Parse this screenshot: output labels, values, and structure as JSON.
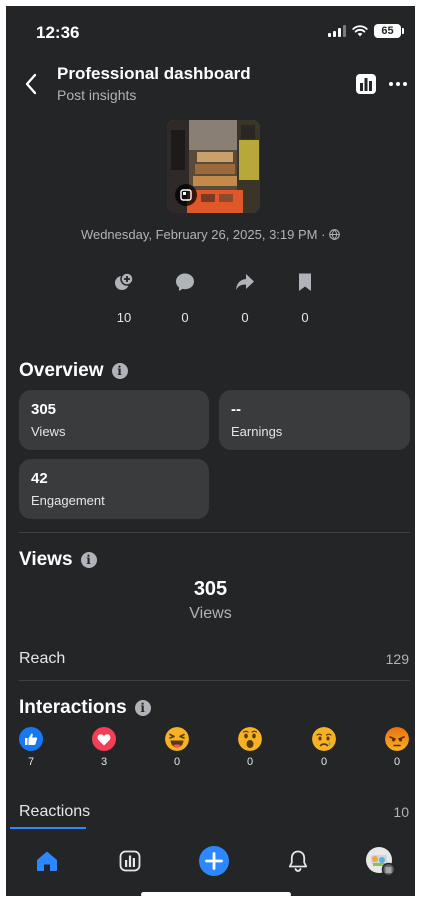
{
  "status_bar": {
    "time": "12:36",
    "battery": "65"
  },
  "header": {
    "title": "Professional dashboard",
    "subtitle": "Post insights"
  },
  "post": {
    "date": "Wednesday, February 26, 2025, 3:19 PM ·"
  },
  "stats": [
    {
      "icon": "reshare-icon",
      "value": "10"
    },
    {
      "icon": "comment-icon",
      "value": "0"
    },
    {
      "icon": "share-icon",
      "value": "0"
    },
    {
      "icon": "bookmark-icon",
      "value": "0"
    }
  ],
  "overview": {
    "title": "Overview",
    "cards": [
      {
        "value": "305",
        "label": "Views"
      },
      {
        "value": "--",
        "label": "Earnings"
      },
      {
        "value": "42",
        "label": "Engagement"
      }
    ]
  },
  "views": {
    "title": "Views",
    "total": "305",
    "caption": "Views",
    "reach_label": "Reach",
    "reach_value": "129"
  },
  "interactions": {
    "title": "Interactions",
    "reactions": [
      {
        "icon": "like-icon",
        "count": "7",
        "color": "#1877f2"
      },
      {
        "icon": "love-icon",
        "count": "3",
        "color": "#f33e58"
      },
      {
        "icon": "haha-icon",
        "count": "0",
        "color": "#f7b125"
      },
      {
        "icon": "wow-icon",
        "count": "0",
        "color": "#f7b125"
      },
      {
        "icon": "sad-icon",
        "count": "0",
        "color": "#f7b125"
      },
      {
        "icon": "angry-icon",
        "count": "0",
        "color": "#e9710f"
      }
    ],
    "reactions_label": "Reactions",
    "reactions_total": "10"
  },
  "nav": {
    "accent": "#2d88ff",
    "items": [
      "home-icon",
      "dashboard-icon",
      "create-icon",
      "notifications-icon",
      "profile-avatar"
    ]
  }
}
